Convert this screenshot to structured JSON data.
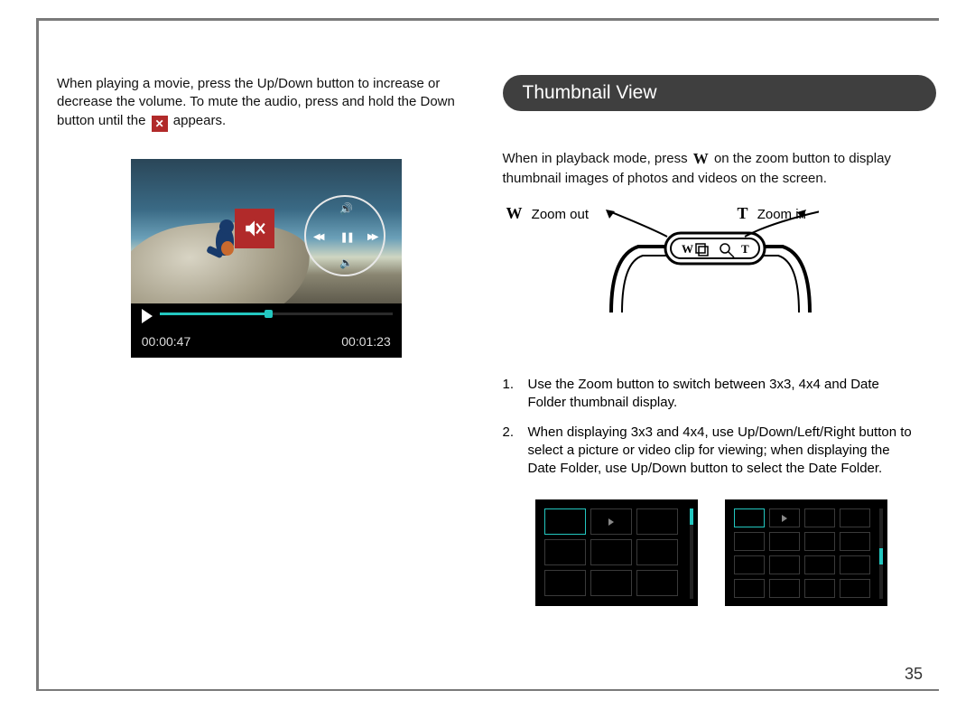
{
  "left": {
    "para_before_icon": "When playing a movie, press the Up/Down button to increase or decrease the volume. To mute the audio, press and hold the Down button until the",
    "para_after_icon": "appears.",
    "time_elapsed": "00:00:47",
    "time_total": "00:01:23"
  },
  "right": {
    "section_title": "Thumbnail View",
    "intro_before_w": "When in playback mode, press",
    "intro_after_w": "on the zoom button to display thumbnail images of photos and videos on the screen.",
    "zoom_out_letter": "W",
    "zoom_out_label": "Zoom out",
    "zoom_in_letter": "T",
    "zoom_in_label": "Zoom in",
    "list": {
      "n1": "1.",
      "t1": "Use the Zoom button to switch between 3x3, 4x4 and Date Folder thumbnail display.",
      "n2": "2.",
      "t2": "When displaying 3x3 and 4x4, use Up/Down/Left/Right button to select a picture or video clip for viewing; when displaying the Date Folder, use Up/Down button to select the Date Folder."
    }
  },
  "page_number": "35"
}
